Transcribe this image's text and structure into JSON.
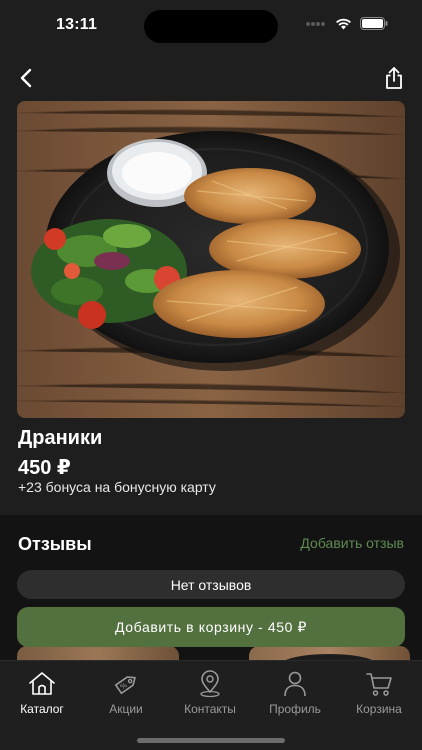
{
  "status_bar": {
    "time": "13:11"
  },
  "header": {
    "back_icon": "chevron-left-icon",
    "share_icon": "share-icon"
  },
  "product": {
    "image_alt": "draniki-photo",
    "title": "Драники",
    "price": "450 ₽",
    "bonus": "+23 бонуса на бонусную карту"
  },
  "reviews": {
    "title": "Отзывы",
    "add_link": "Добавить отзыв",
    "empty_text": "Нет отзывов"
  },
  "cart_button": {
    "label": "Добавить в корзину - 450 ₽"
  },
  "tab_bar": {
    "items": [
      {
        "label": "Каталог",
        "icon": "home-icon",
        "active": true
      },
      {
        "label": "Акции",
        "icon": "tag-icon",
        "active": false
      },
      {
        "label": "Контакты",
        "icon": "map-pin-icon",
        "active": false
      },
      {
        "label": "Профиль",
        "icon": "user-icon",
        "active": false
      },
      {
        "label": "Корзина",
        "icon": "cart-icon",
        "active": false
      }
    ]
  },
  "colors": {
    "background": "#1e1e1e",
    "panel": "#131313",
    "accent_green": "#53703f",
    "link_green": "#5f8a52",
    "pill": "#2e2e2e"
  }
}
